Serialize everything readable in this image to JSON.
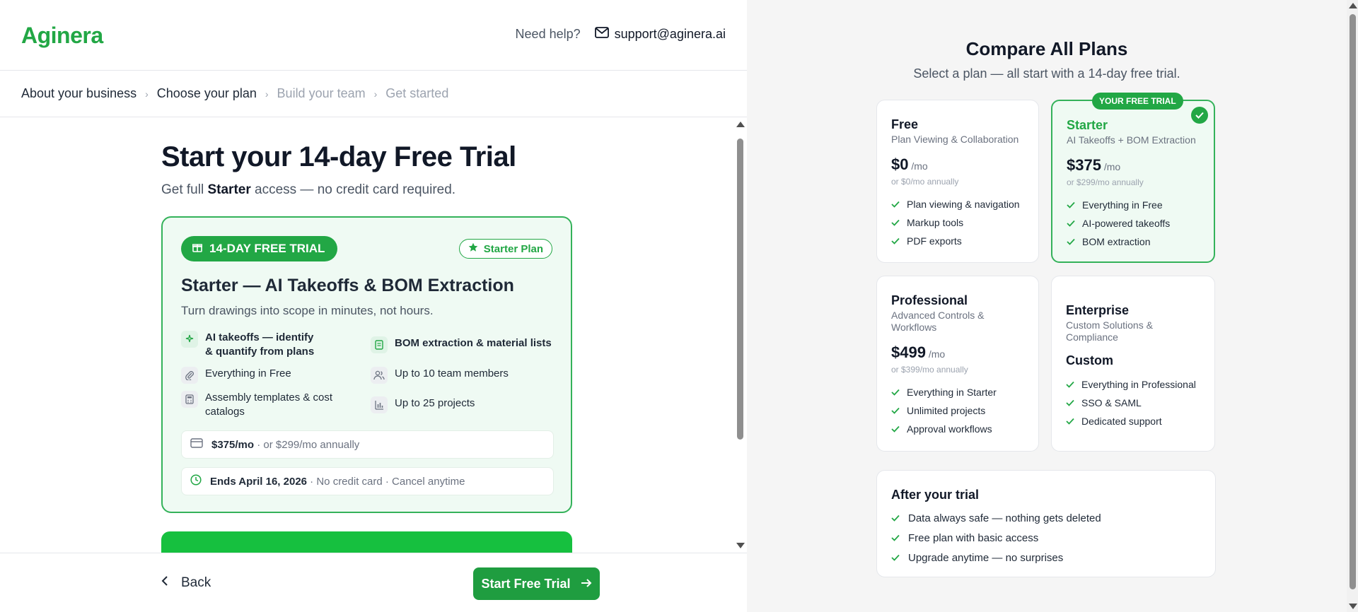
{
  "brand": {
    "logo_text": "Aginera",
    "accent": "#22a745"
  },
  "header": {
    "help_text": "Need help?",
    "support_email": "support@aginera.ai"
  },
  "breadcrumbs": [
    {
      "label": "About your business",
      "state": "done"
    },
    {
      "label": "Choose your plan",
      "state": "current"
    },
    {
      "label": "Build your team",
      "state": "upcoming"
    },
    {
      "label": "Get started",
      "state": "upcoming"
    }
  ],
  "main": {
    "title": "Start your 14-day Free Trial",
    "subtitle_pre": "Get full ",
    "subtitle_bold": "Starter",
    "subtitle_post": " access — no credit card required.",
    "trial_card": {
      "trial_pill": "14-DAY FREE TRIAL",
      "plan_pill": "Starter Plan",
      "title": "Starter — AI Takeoffs & BOM Extraction",
      "subtitle": "Turn drawings into scope in minutes, not hours.",
      "features": [
        {
          "label": "AI takeoffs — identify & quantify from plans",
          "icon": "sparkles-icon",
          "bold": true
        },
        {
          "label": "BOM extraction & material lists",
          "icon": "document-icon",
          "bold": true
        },
        {
          "label": "Everything in Free",
          "icon": "paperclip-icon",
          "bold": false
        },
        {
          "label": "Up to 10 team members",
          "icon": "users-icon",
          "bold": false
        },
        {
          "label": "Assembly templates & cost catalogs",
          "icon": "calculator-icon",
          "bold": false
        },
        {
          "label": "Up to 25 projects",
          "icon": "bar-chart-icon",
          "bold": false
        }
      ],
      "price_bold": "$375/mo",
      "price_rest": " · or $299/mo annually",
      "ends_bold": "Ends April 16, 2026",
      "ends_rest": " · No credit card · Cancel anytime"
    }
  },
  "footer": {
    "back_label": "Back",
    "start_label": "Start Free Trial"
  },
  "compare": {
    "title": "Compare All Plans",
    "subtitle": "Select a plan — all start with a 14-day free trial.",
    "plans": [
      {
        "name": "Free",
        "desc": "Plan Viewing & Collaboration",
        "price": "$0",
        "per": " /mo",
        "annual": "or $0/mo annually",
        "features": [
          "Plan viewing & navigation",
          "Markup tools",
          "PDF exports"
        ]
      },
      {
        "name": "Starter",
        "desc": "AI Takeoffs + BOM Extraction",
        "price": "$375",
        "per": " /mo",
        "annual": "or $299/mo annually",
        "badge": "YOUR FREE TRIAL",
        "features": [
          "Everything in Free",
          "AI-powered takeoffs",
          "BOM extraction"
        ]
      },
      {
        "name": "Professional",
        "desc": "Advanced Controls & Workflows",
        "price": "$499",
        "per": " /mo",
        "annual": "or $399/mo annually",
        "features": [
          "Everything in Starter",
          "Unlimited projects",
          "Approval workflows"
        ]
      },
      {
        "name": "Enterprise",
        "desc": "Custom Solutions & Compliance",
        "price": "Custom",
        "features": [
          "Everything in Professional",
          "SSO & SAML",
          "Dedicated support"
        ]
      }
    ],
    "after": {
      "title": "After your trial",
      "items": [
        "Data always safe — nothing gets deleted",
        "Free plan with basic access",
        "Upgrade anytime — no surprises"
      ]
    }
  }
}
